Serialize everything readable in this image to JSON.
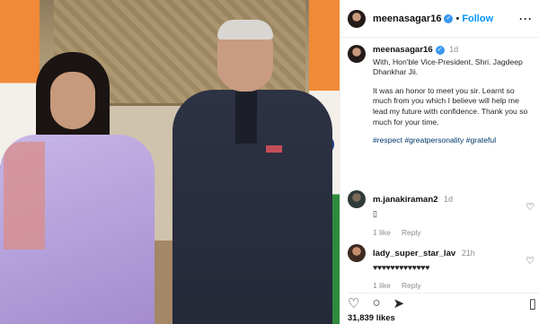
{
  "post": {
    "username": "meenasagar16",
    "follow_label": "Follow",
    "separator": "•",
    "more_label": "···",
    "verified_mark": "✓"
  },
  "caption": {
    "username": "meenasagar16",
    "time": "1d",
    "line1": "With, Hon'ble Vice-President, Shri. Jagdeep Dhankhar Jii.",
    "line2": "It was an honor to meet you sir. Learnt so much from you which I believe will help me lead my future with confidence. Thank you so much for your time.",
    "hashtags": "#respect #greatpersonality #grateful"
  },
  "comments": [
    {
      "username": "m.janakiraman2",
      "time": "1d",
      "text": "▯",
      "likes": "1 like",
      "reply_label": "Reply"
    },
    {
      "username": "lady_super_star_lav",
      "time": "21h",
      "text": "♥♥♥♥♥♥♥♥♥♥♥♥♥",
      "likes": "1 like",
      "reply_label": "Reply"
    }
  ],
  "actions": {
    "like_icon": "heart-icon",
    "comment_icon": "comment-icon",
    "share_icon": "share-icon",
    "save_icon": "bookmark-icon"
  },
  "likes_count": "31,839 likes",
  "colors": {
    "accent": "#0095f6",
    "verified": "#3897f0",
    "hashtag": "#00376b",
    "muted": "#8e8e8e"
  }
}
